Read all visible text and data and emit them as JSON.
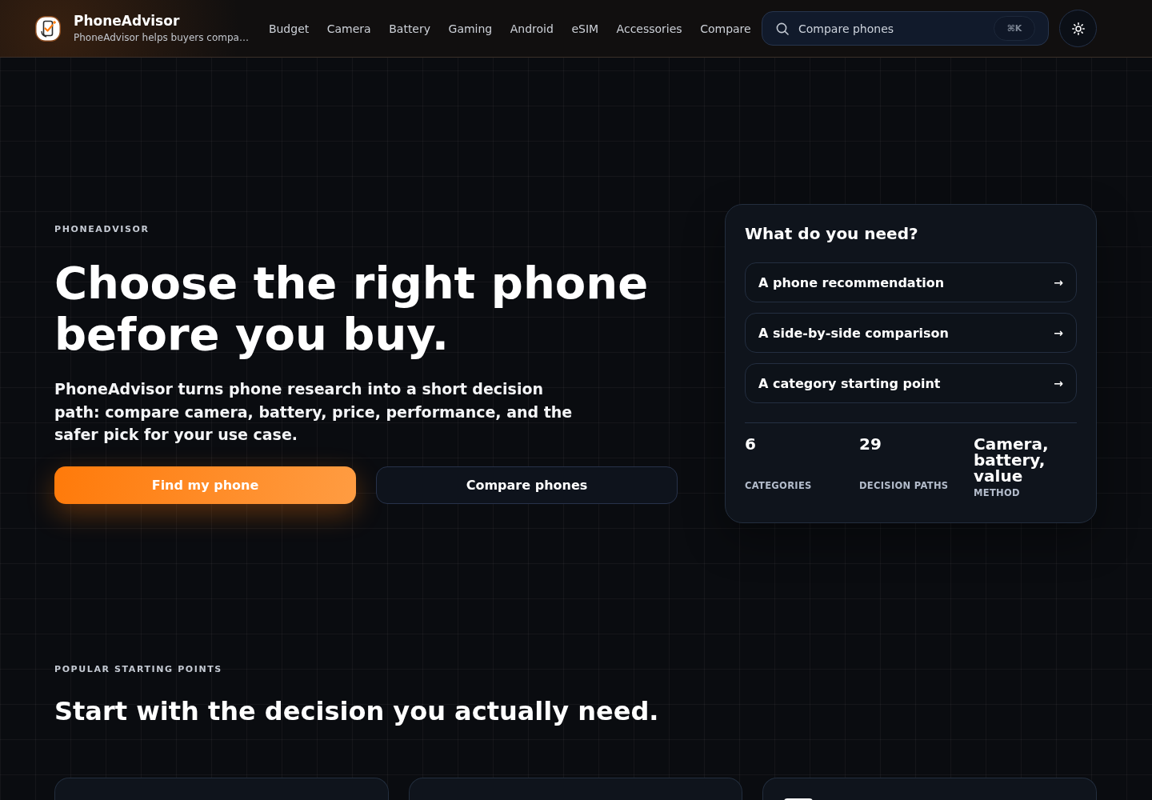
{
  "header": {
    "brand": {
      "name": "PhoneAdvisor",
      "tagline": "PhoneAdvisor helps buyers compa…"
    },
    "nav": [
      {
        "label": "Budget"
      },
      {
        "label": "Camera"
      },
      {
        "label": "Battery"
      },
      {
        "label": "Gaming"
      },
      {
        "label": "Android"
      },
      {
        "label": "eSIM"
      },
      {
        "label": "Accessories"
      },
      {
        "label": "Compare"
      }
    ],
    "search": {
      "placeholder": "Compare phones",
      "shortcut": "⌘K"
    }
  },
  "hero": {
    "eyebrow": "PHONEADVISOR",
    "title": "Choose the right phone before you buy.",
    "lead": "PhoneAdvisor turns phone research into a short decision path: compare camera, battery, price, performance, and the safer pick for your use case.",
    "buttons": [
      {
        "label": "Find my phone",
        "kind": "primary"
      },
      {
        "label": "Compare phones",
        "kind": "secondary"
      }
    ]
  },
  "need_card": {
    "title": "What do you need?",
    "options": [
      {
        "label": "A phone recommendation",
        "arrow": "→"
      },
      {
        "label": "A side-by-side comparison",
        "arrow": "→"
      },
      {
        "label": "A category starting point",
        "arrow": "→"
      }
    ],
    "stats": [
      {
        "value": "6",
        "label": "CATEGORIES"
      },
      {
        "value": "29",
        "label": "DECISION PATHS"
      },
      {
        "value": "Camera, battery, value",
        "label": "METHOD"
      }
    ]
  },
  "popular": {
    "eyebrow": "POPULAR STARTING POINTS",
    "title": "Start with the decision you actually need.",
    "cards": [
      {
        "kind": "plain"
      },
      {
        "kind": "plain"
      },
      {
        "kind": "icon"
      }
    ]
  }
}
